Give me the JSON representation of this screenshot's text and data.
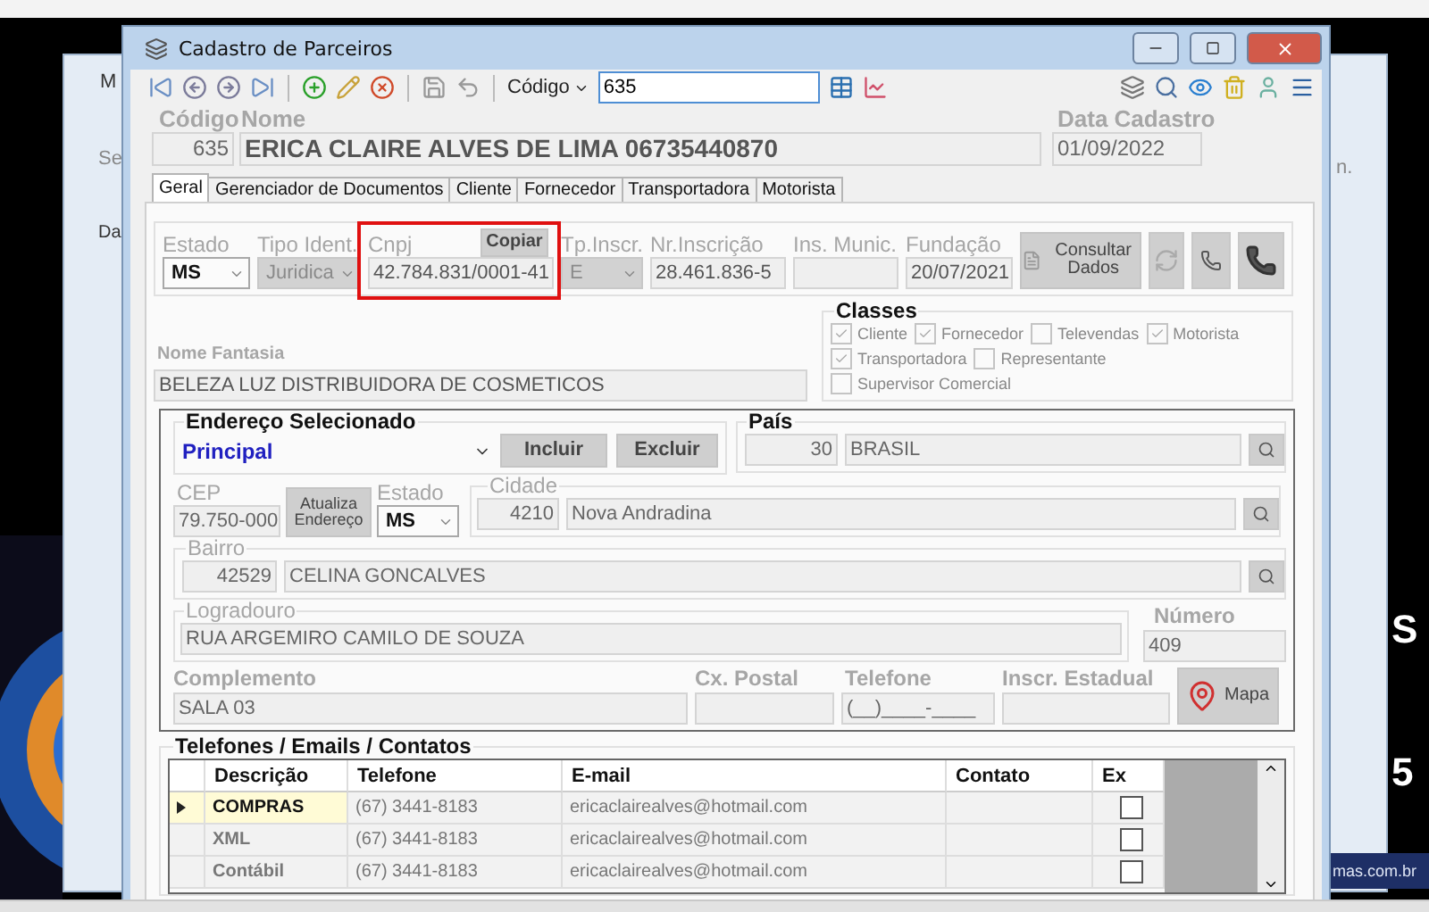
{
  "desktop": {
    "back_window": {
      "title": "M",
      "text_1": "Se",
      "text_2": "Da",
      "text_3": "n."
    },
    "wallpaper_texts": [
      "S",
      "5"
    ],
    "brand": "mas.com.br"
  },
  "window": {
    "title": "Cadastro de Parceiros"
  },
  "toolbar": {
    "field_selector": "Código",
    "search_value": "635"
  },
  "header": {
    "code_label": "Código",
    "code": "635",
    "name_label": "Nome",
    "name": "ERICA CLAIRE ALVES DE LIMA 06735440870",
    "date_label": "Data Cadastro",
    "date": "01/09/2022"
  },
  "tabs": [
    {
      "label": "Geral",
      "selected": true
    },
    {
      "label": "Gerenciador de Documentos",
      "selected": false
    },
    {
      "label": "Cliente",
      "selected": false
    },
    {
      "label": "Fornecedor",
      "selected": false
    },
    {
      "label": "Transportadora",
      "selected": false
    },
    {
      "label": "Motorista",
      "selected": false
    }
  ],
  "identification": {
    "copy_button": "Copiar",
    "consult_button": "Consultar Dados",
    "fields": [
      {
        "label": "Estado",
        "value": "MS",
        "kind": "combo",
        "disabled": false,
        "highlighted": false
      },
      {
        "label": "Tipo Ident.",
        "value": "Juridica",
        "kind": "combo",
        "disabled": true,
        "highlighted": false
      },
      {
        "label": "Cnpj",
        "value": "42.784.831/0001-41",
        "kind": "text",
        "highlighted": true
      },
      {
        "label": "Tp.Inscr.",
        "value": "E",
        "kind": "combo",
        "disabled": true,
        "highlighted": false
      },
      {
        "label": "Nr.Inscrição",
        "value": "28.461.836-5",
        "kind": "text",
        "highlighted": false
      },
      {
        "label": "Ins. Munic.",
        "kind": "text",
        "highlighted": false
      },
      {
        "label": "Fundação",
        "value": "20/07/2021",
        "kind": "text",
        "highlighted": false
      }
    ]
  },
  "trade_name": {
    "label": "Nome Fantasia",
    "value": "BELEZA LUZ DISTRIBUIDORA DE COSMETICOS"
  },
  "classes": {
    "title": "Classes",
    "items": [
      {
        "label": "Cliente",
        "checked": true
      },
      {
        "label": "Fornecedor",
        "checked": true
      },
      {
        "label": "Televendas",
        "checked": false
      },
      {
        "label": "Motorista",
        "checked": true
      },
      {
        "label": "Transportadora",
        "checked": true
      },
      {
        "label": "Representante",
        "checked": false
      },
      {
        "label": "Supervisor Comercial",
        "checked": false
      }
    ]
  },
  "address": {
    "selected_title": "Endereço Selecionado",
    "selected_value": "Principal",
    "add_button": "Incluir",
    "delete_button": "Excluir",
    "country_label": "País",
    "country_code": "30",
    "country": "BRASIL",
    "cep_label": "CEP",
    "cep": "79.750-000",
    "update_button": "Atualiza Endereço",
    "state_label": "Estado",
    "state": "MS",
    "city_label": "Cidade",
    "city_code": "4210",
    "city": "Nova Andradina",
    "district_label": "Bairro",
    "district_code": "42529",
    "district": "CELINA GONCALVES",
    "street_label": "Logradouro",
    "street": "RUA ARGEMIRO CAMILO DE SOUZA",
    "number_label": "Número",
    "number": "409",
    "complement_label": "Complemento",
    "complement": "SALA 03",
    "postal_box_label": "Cx. Postal",
    "phone_label": "Telefone",
    "phone_placeholder": "(__)____-____",
    "state_reg_label": "Inscr. Estadual",
    "map_button": "Mapa"
  },
  "contacts": {
    "title": "Telefones / Emails / Contatos",
    "columns": [
      "Descrição",
      "Telefone",
      "E-mail",
      "Contato",
      "Ex"
    ],
    "rows": [
      {
        "description": "COMPRAS",
        "phone": "(67) 3441-8183",
        "email": "ericaclairealves@hotmail.com",
        "selected": true,
        "ex": false
      },
      {
        "description": "XML",
        "phone": "(67) 3441-8183",
        "email": "ericaclairealves@hotmail.com",
        "selected": false,
        "ex": false
      },
      {
        "description": "Contábil",
        "phone": "(67) 3441-8183",
        "email": "ericaclairealves@hotmail.com",
        "selected": false,
        "ex": false
      }
    ]
  }
}
